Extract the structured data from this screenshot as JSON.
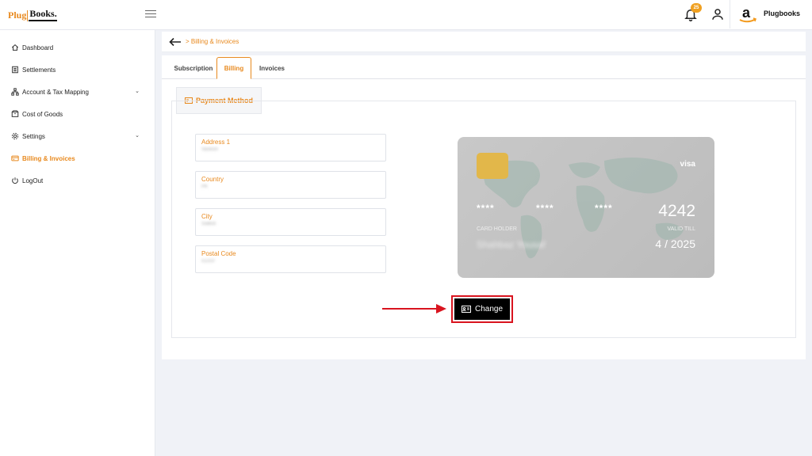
{
  "logo": {
    "part1": "Plug",
    "part2": "Books."
  },
  "header": {
    "notification_count": "25",
    "brand_name": "Plugbooks"
  },
  "sidebar": {
    "items": [
      {
        "label": "Dashboard",
        "icon": "home-icon"
      },
      {
        "label": "Settlements",
        "icon": "document-icon"
      },
      {
        "label": "Account & Tax Mapping",
        "icon": "hierarchy-icon",
        "expandable": true
      },
      {
        "label": "Cost of Goods",
        "icon": "box-icon"
      },
      {
        "label": "Settings",
        "icon": "gear-icon",
        "expandable": true
      },
      {
        "label": "Billing & Invoices",
        "icon": "card-icon",
        "active": true
      },
      {
        "label": "LogOut",
        "icon": "power-icon"
      }
    ]
  },
  "breadcrumb": {
    "label": "Billing & Invoices"
  },
  "tabs": [
    {
      "label": "Subscription"
    },
    {
      "label": "Billing",
      "active": true
    },
    {
      "label": "Invoices"
    }
  ],
  "payment": {
    "section_title": "Payment Method",
    "fields": [
      {
        "label": "Address 1",
        "value": "Vaskion"
      },
      {
        "label": "Country",
        "value": "PK"
      },
      {
        "label": "City",
        "value": "Sialkot"
      },
      {
        "label": "Postal Code",
        "value": "51310"
      }
    ],
    "card": {
      "brand": "visa",
      "masked_groups": [
        "****",
        "****",
        "****"
      ],
      "last4": "4242",
      "holder_label": "CARD HOLDER",
      "holder_name": "Shahbaz Yousaf",
      "valid_label": "VALID TILL",
      "valid_value": "4 / 2025"
    },
    "change_button": "Change"
  },
  "colors": {
    "accent": "#e8891e",
    "highlight": "#d9141f"
  }
}
